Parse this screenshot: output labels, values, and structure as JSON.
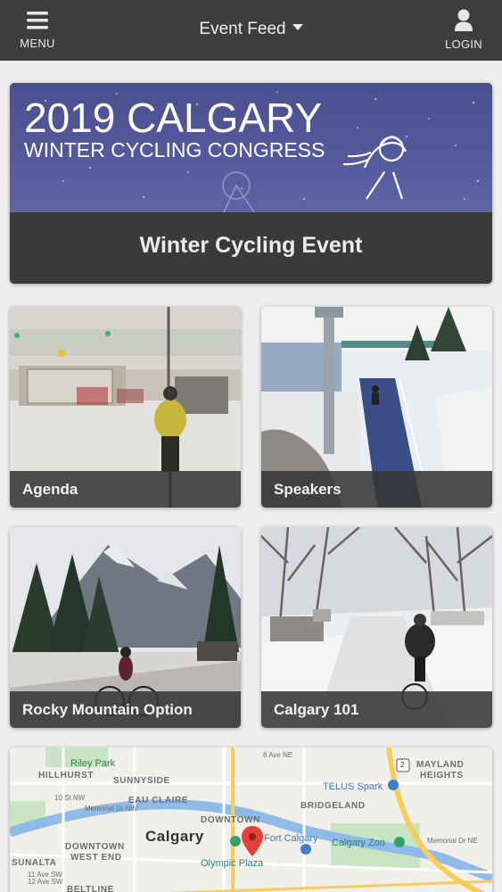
{
  "topbar": {
    "menu_label": "MENU",
    "feed_title": "Event Feed",
    "login_label": "LOGIN",
    "menu_icon": "hamburger-icon",
    "feed_icon": "caret-down-icon",
    "login_icon": "user-icon",
    "bg_color": "#3d3d3d"
  },
  "banner": {
    "line1": "2019 CALGARY",
    "line2": "WINTER CYCLING CONGRESS",
    "caption": "Winter Cycling Event",
    "bg_color": "#555a9c"
  },
  "tiles": [
    {
      "label": "Agenda"
    },
    {
      "label": "Speakers"
    },
    {
      "label": "Rocky Mountain Option"
    },
    {
      "label": "Calgary 101"
    }
  ],
  "map": {
    "labels": {
      "riley_park": "Riley Park",
      "hillhurst": "HILLHURST",
      "sunnyside": "SUNNYSIDE",
      "eau_claire": "EAU CLAIRE",
      "downtown": "DOWNTOWN",
      "calgary": "Calgary",
      "downtown_west_end_1": "DOWNTOWN",
      "downtown_west_end_2": "WEST END",
      "sunalta": "SUNALTA",
      "beltline": "BELTLINE",
      "olympic_plaza": "Olympic Plaza",
      "fort_calgary": "Fort Calgary",
      "calgary_zoo": "Calgary Zoo",
      "telus_spark": "TELUS Spark",
      "bridgeland": "BRIDGELAND",
      "mayland_1": "MAYLAND",
      "mayland_2": "HEIGHTS",
      "highway_2": "2",
      "memorial_dr_nw": "Memorial Dr NW",
      "memorial_dr_ne": "Memorial Dr NE",
      "ave_8_ne": "8 Ave NE",
      "ave_11_sw": "11 Ave SW",
      "ave_12_sw": "12 Ave SW",
      "st_10_nw": "10 St NW"
    }
  }
}
